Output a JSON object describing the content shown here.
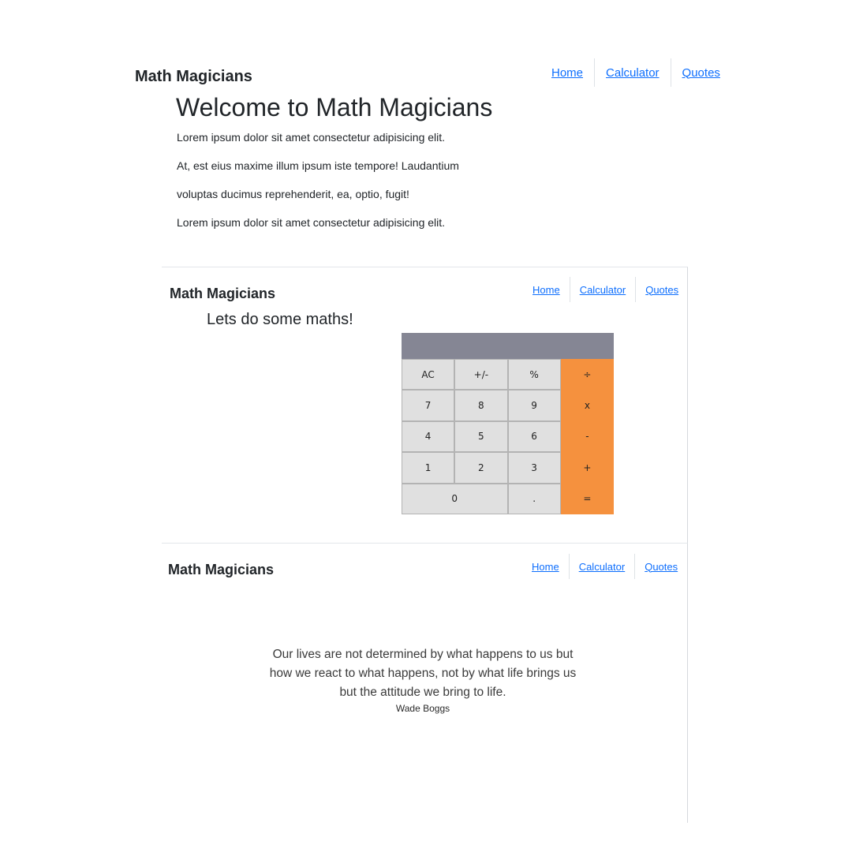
{
  "section_home": {
    "brand": "Math Magicians",
    "nav": [
      "Home",
      "Calculator",
      "Quotes"
    ],
    "title": "Welcome to Math Magicians",
    "paragraphs": [
      "Lorem ipsum dolor sit amet consectetur adipisicing elit.",
      "At, est eius maxime illum ipsum iste tempore! Laudantium",
      "voluptas ducimus reprehenderit, ea, optio, fugit!",
      "Lorem ipsum dolor sit amet consectetur adipisicing elit."
    ]
  },
  "section_calculator": {
    "brand": "Math Magicians",
    "nav": [
      "Home",
      "Calculator",
      "Quotes"
    ],
    "heading": "Lets do some maths!",
    "display": "",
    "keys": [
      "AC",
      "+/-",
      "%",
      "÷",
      "7",
      "8",
      "9",
      "x",
      "4",
      "5",
      "6",
      "-",
      "1",
      "2",
      "3",
      "+",
      "0",
      ".",
      "="
    ]
  },
  "section_quotes": {
    "brand": "Math Magicians",
    "nav": [
      "Home",
      "Calculator",
      "Quotes"
    ],
    "quote": "Our lives are not determined by what happens to us but how we react to what happens, not by what life brings us but the attitude we bring to life.",
    "author": "Wade Boggs"
  },
  "colors": {
    "link": "#0d6efd",
    "operator_key": "#f5913e",
    "display_bg": "#858694",
    "key_bg": "#e0e0e0"
  }
}
